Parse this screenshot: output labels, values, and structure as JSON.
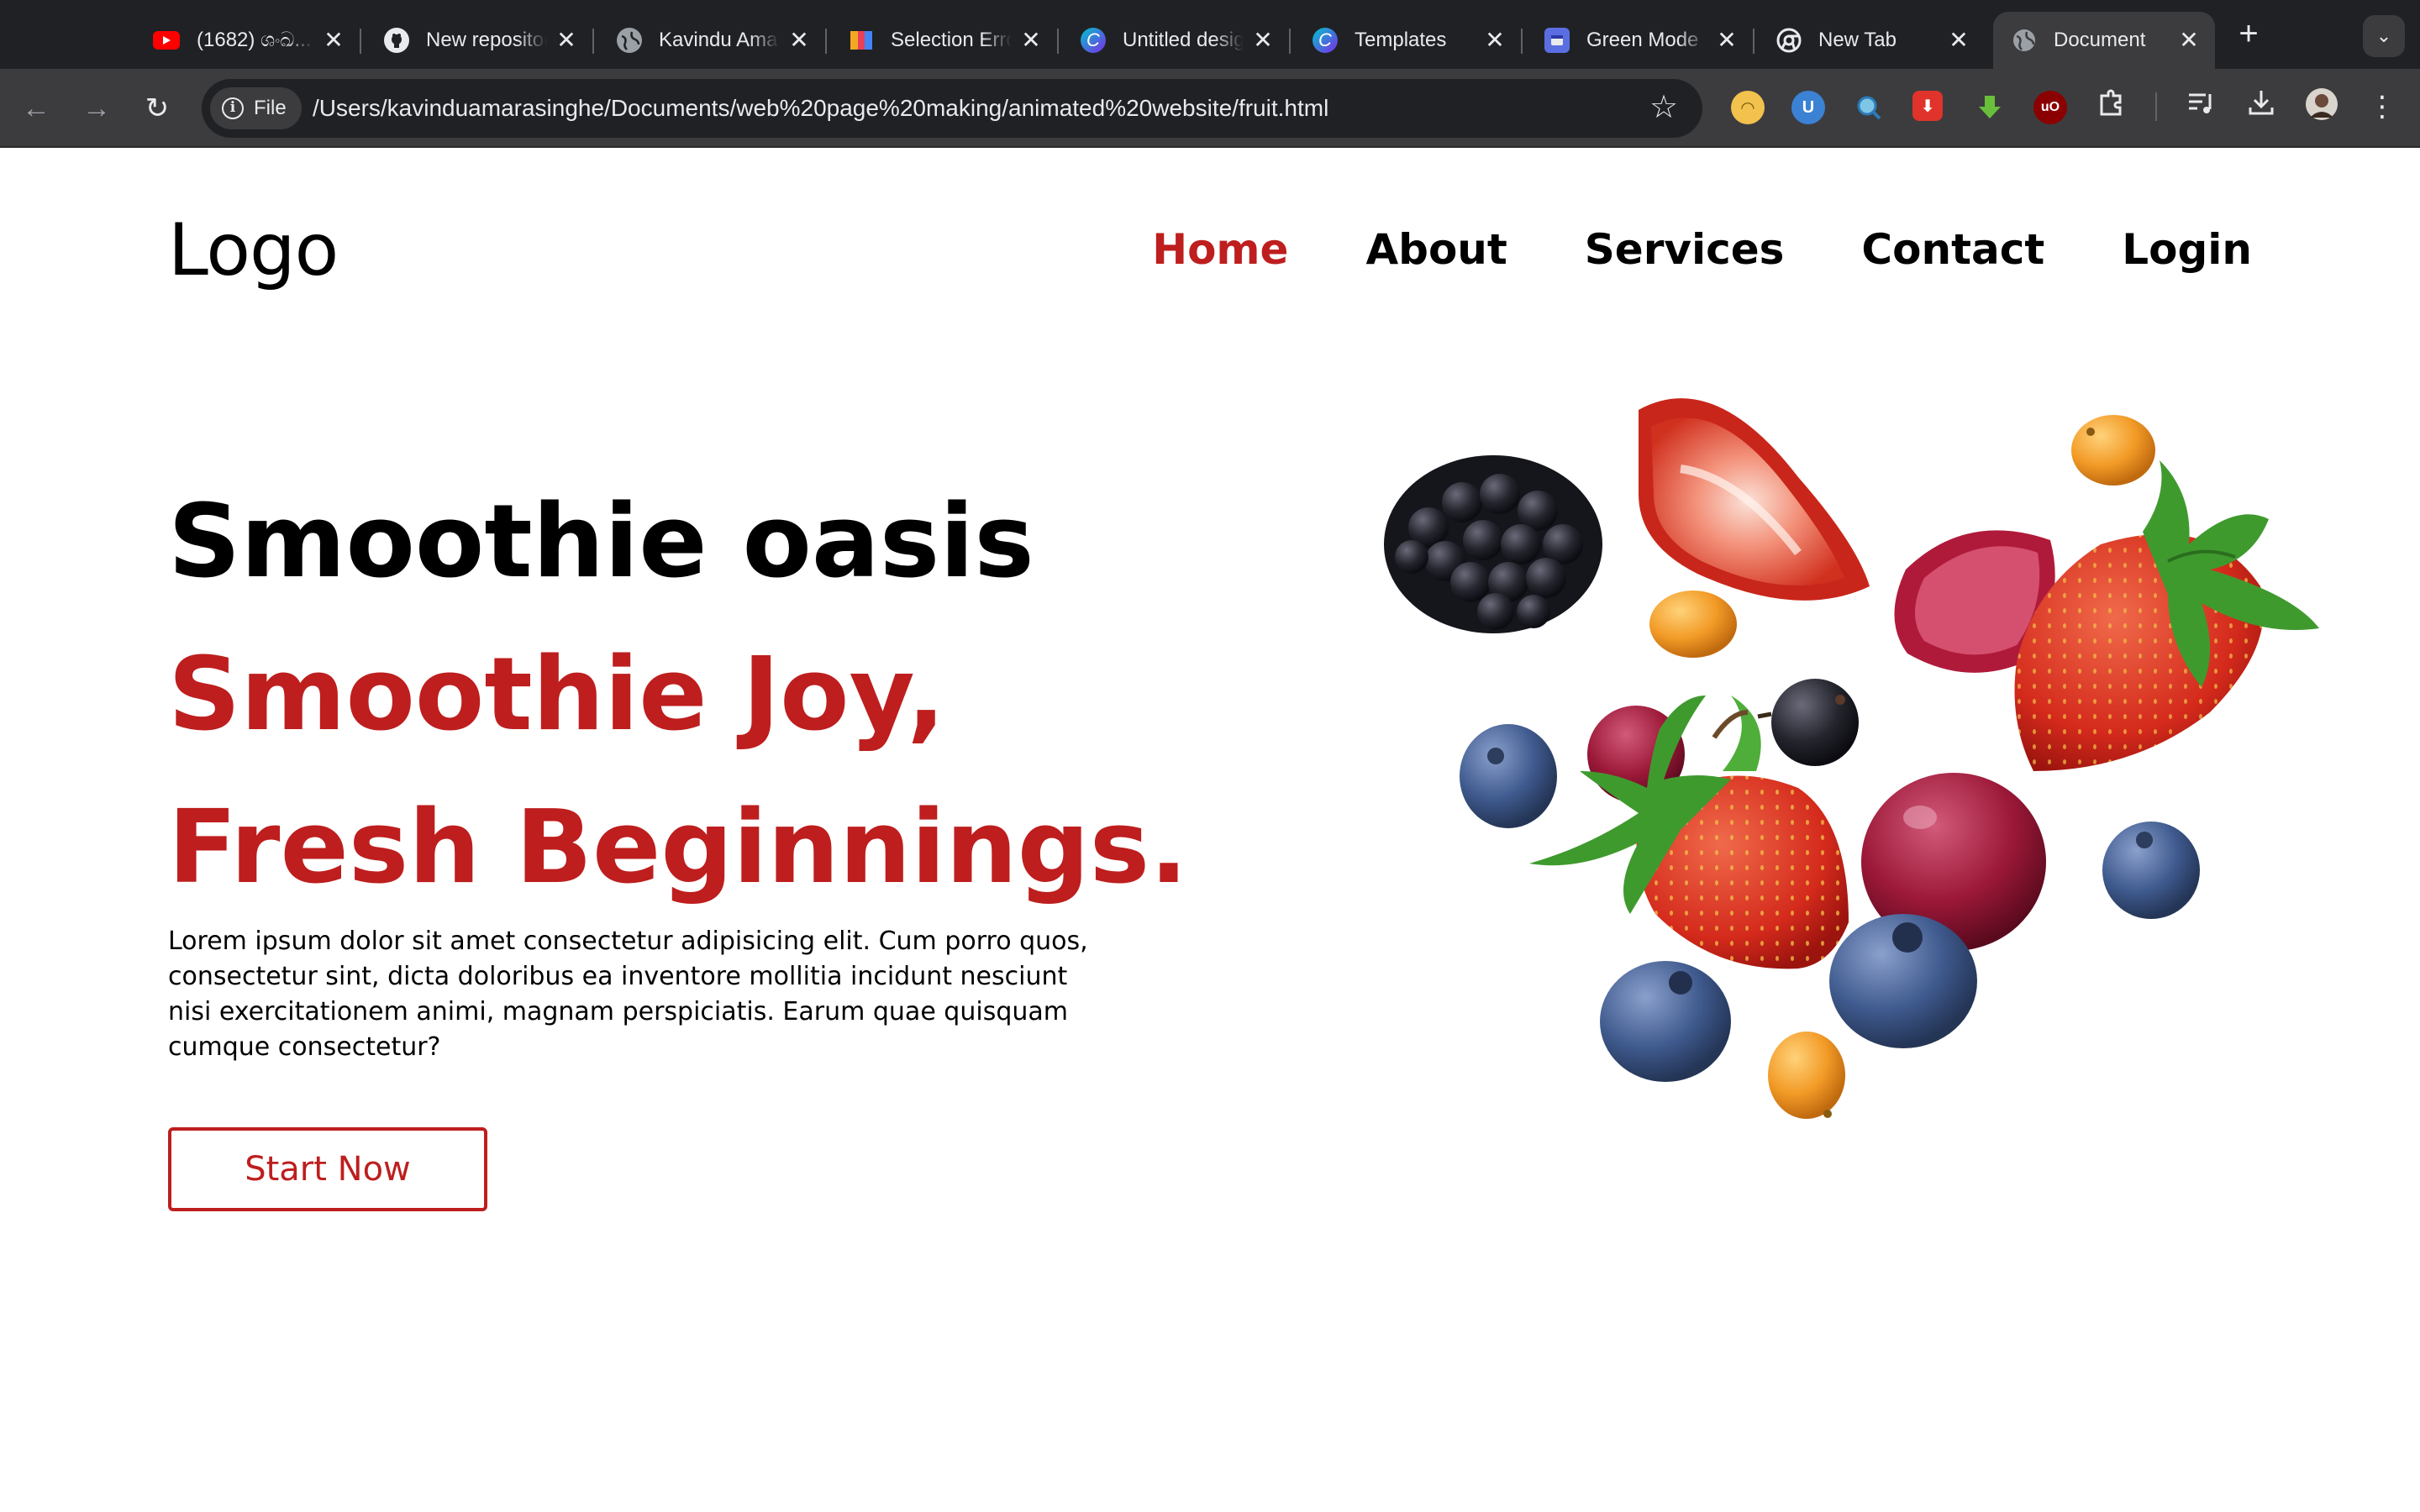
{
  "browser": {
    "tabs": [
      {
        "title": "(1682) ශංඛ...",
        "favicon": "youtube-icon",
        "close": "✕"
      },
      {
        "title": "New repository",
        "favicon": "github-icon",
        "close": "✕"
      },
      {
        "title": "Kavindu Amarasinghe",
        "favicon": "globe-icon",
        "close": "✕"
      },
      {
        "title": "Selection Error",
        "favicon": "selection-icon",
        "close": "✕"
      },
      {
        "title": "Untitled design",
        "favicon": "canva-icon",
        "close": "✕"
      },
      {
        "title": "Templates",
        "favicon": "canva-icon",
        "close": "✕"
      },
      {
        "title": "Green Mode",
        "favicon": "app-icon",
        "close": "✕"
      },
      {
        "title": "New Tab",
        "favicon": "chrome-icon",
        "close": "✕"
      },
      {
        "title": "Document",
        "favicon": "globe-icon",
        "close": "✕",
        "active": true
      }
    ],
    "new_tab": "+",
    "tab_search": "⌄",
    "nav": {
      "back": "←",
      "forward": "→",
      "reload": "↻"
    },
    "address": {
      "chip_label": "File",
      "chip_info": "i",
      "url": "/Users/kavinduamarasinghe/Documents/web%20page%20making/animated%20website/fruit.html",
      "bookmark": "☆"
    },
    "extensions": [
      {
        "name": "smiley-extension-icon",
        "glyph": "◠",
        "color": "#f2c14e"
      },
      {
        "name": "u-extension-icon",
        "glyph": "U",
        "color": "#3b82d4"
      },
      {
        "name": "magnifier-extension-icon",
        "glyph": "🔍",
        "color": "#3c3c3f"
      },
      {
        "name": "download-red-extension-icon",
        "glyph": "⬇",
        "color": "#e0332b"
      },
      {
        "name": "download-green-extension-icon",
        "glyph": "⬇",
        "color": "#3c3c3f"
      },
      {
        "name": "ublock-extension-icon",
        "glyph": "uO",
        "color": "#8b0000"
      }
    ],
    "toolbar_icons": {
      "puzzle": "⧉",
      "media": "≡♪",
      "download": "⤓",
      "menu": "⋮"
    },
    "colors": {
      "tabstrip": "#202124",
      "toolbar": "#3c3c3f",
      "omnibox": "#202124",
      "text": "#e8eaed"
    }
  },
  "site": {
    "logo": "Logo",
    "nav": [
      {
        "label": "Home",
        "active": true
      },
      {
        "label": "About",
        "active": false
      },
      {
        "label": "Services",
        "active": false
      },
      {
        "label": "Contact",
        "active": false
      },
      {
        "label": "Login",
        "active": false
      }
    ],
    "hero": {
      "title": "Smoothie oasis",
      "tagline_1": "Smoothie Joy,",
      "tagline_2": "Fresh Beginnings.",
      "text": "Lorem ipsum dolor sit amet consectetur adipisicing elit. Cum porro quos, consectetur sint, dicta doloribus ea inventore mollitia incidunt nesciunt nisi exercitationem animi, magnam perspiciatis. Earum quae quisquam cumque consectetur?",
      "cta": "Start Now"
    },
    "colors": {
      "accent": "#be1e1e",
      "text": "#000000",
      "background": "#ffffff"
    },
    "image": {
      "name": "floating-berries-image"
    }
  }
}
